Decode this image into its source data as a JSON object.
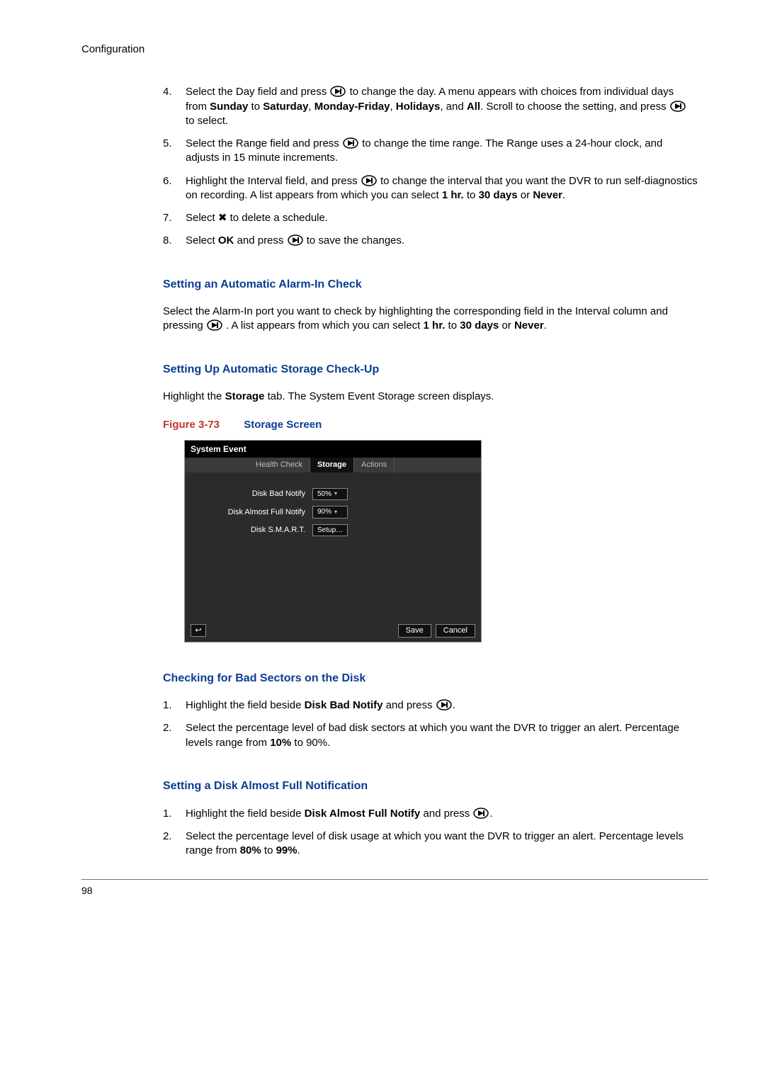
{
  "header": "Configuration",
  "list1": {
    "items": [
      {
        "n": "4.",
        "pre": "Select the Day field and press ",
        "post": " to change the day. A menu appears with choices from individual days from ",
        "b1": "Sunday",
        "t1": " to ",
        "b2": "Saturday",
        "t2": ", ",
        "b3": "Monday-Friday",
        "t3": ", ",
        "b4": "Holidays",
        "t4": ", and ",
        "b5": "All",
        "t5": ". Scroll to choose the setting, and press ",
        "tail": " to select."
      },
      {
        "n": "5.",
        "pre": "Select the Range field and press ",
        "post": " to change the time range. The Range uses a 24-hour clock, and adjusts in 15 minute increments."
      },
      {
        "n": "6.",
        "pre": "Highlight the Interval field, and press ",
        "post": " to change the interval that you want the DVR to run self-diagnostics on recording. A list appears from which you can select ",
        "b1": "1 hr.",
        "t1": " to ",
        "b2": "30 days",
        "t2": " or ",
        "b3": "Never",
        "t3": "."
      },
      {
        "n": "7.",
        "pre": "Select ✖ to delete a schedule."
      },
      {
        "n": "8.",
        "pre": "Select ",
        "b1": "OK",
        "t1": " and press ",
        "post": " to save the changes."
      }
    ]
  },
  "sec1": {
    "heading": "Setting an Automatic Alarm-In Check",
    "p_pre": "Select the Alarm-In port you want to check by highlighting the corresponding field in the Interval column and pressing ",
    "p_mid": ". A list appears from which you can select ",
    "b1": "1 hr.",
    "t1": " to ",
    "b2": "30 days",
    "t2": " or ",
    "b3": "Never",
    "t3": "."
  },
  "sec2": {
    "heading": "Setting Up Automatic Storage Check-Up",
    "p1a": "Highlight the ",
    "p1b": "Storage",
    "p1c": " tab. The System Event Storage screen displays.",
    "fig_num": "Figure 3-73",
    "fig_title": "Storage Screen"
  },
  "shot": {
    "title": "System Event",
    "tabs": {
      "t1": "Health Check",
      "t2": "Storage",
      "t3": "Actions"
    },
    "rows": {
      "r1_label": "Disk Bad Notify",
      "r1_val": "50%",
      "r2_label": "Disk Almost Full Notify",
      "r2_val": "90%",
      "r3_label": "Disk S.M.A.R.T.",
      "r3_val": "Setup…"
    },
    "save": "Save",
    "cancel": "Cancel"
  },
  "sec3": {
    "heading": "Checking for Bad Sectors on the Disk",
    "i1_pre": "Highlight the field beside ",
    "i1_b": "Disk Bad Notify",
    "i1_mid": " and press ",
    "i1_post": ".",
    "i2_a": "Select the percentage level of bad disk sectors at which you want the DVR to trigger an alert. Percentage levels range from ",
    "i2_b": "10%",
    "i2_c": " to 90%."
  },
  "sec4": {
    "heading": "Setting a Disk Almost Full Notification",
    "i1_pre": "Highlight the field beside ",
    "i1_b": "Disk Almost Full Notify",
    "i1_mid": " and press ",
    "i1_post": ".",
    "i2_a": "Select the percentage level of disk usage at which you want the DVR to trigger an alert. Percentage levels range from ",
    "i2_b1": "80%",
    "i2_t1": " to ",
    "i2_b2": "99%",
    "i2_t2": "."
  },
  "page_number": "98"
}
